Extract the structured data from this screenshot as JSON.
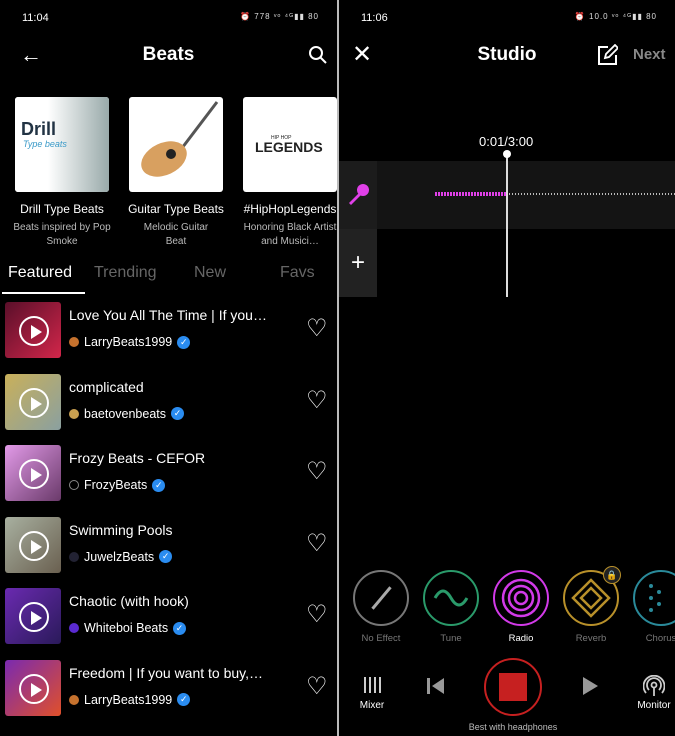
{
  "left": {
    "status": {
      "time": "11:04",
      "icons": "⏰ 778 ᵛᵒ ⁴ᴳ▮▮ 80"
    },
    "header": {
      "title": "Beats",
      "back_icon": "arrow-left-icon",
      "search_icon": "search-icon"
    },
    "collections": [
      {
        "title": "Drill Type Beats",
        "subtitle": "Beats inspired by Pop Smoke",
        "art_text": "Drill",
        "art_sub": "Type beats"
      },
      {
        "title": "Guitar Type Beats",
        "subtitle": "Melodic Guitar Beat"
      },
      {
        "title": "#HipHopLegends",
        "subtitle": "Honoring Black Artist and Musici…",
        "art_text": "LEGENDS",
        "art_sub": "HIP HOP"
      }
    ],
    "tabs": [
      {
        "label": "Featured",
        "active": true
      },
      {
        "label": "Trending"
      },
      {
        "label": "New"
      },
      {
        "label": "Favs"
      }
    ],
    "beats": [
      {
        "title": "Love You All The Time | If you…",
        "author": "LarryBeats1999",
        "colors": [
          "#5a0f2a",
          "#d2264a"
        ],
        "avatar": "#c6722e"
      },
      {
        "title": "complicated",
        "author": "baetovenbeats",
        "colors": [
          "#c9b05a",
          "#8aa0a0"
        ],
        "avatar": "#c9a050"
      },
      {
        "title": "Frozy Beats - CEFOR",
        "author": "FrozyBeats",
        "colors": [
          "#e29ae8",
          "#6a3a6a"
        ],
        "avatar": "#000"
      },
      {
        "title": "Swimming Pools",
        "author": "JuwelzBeats",
        "colors": [
          "#a8b0a0",
          "#6a6050"
        ],
        "avatar": "#223"
      },
      {
        "title": "Chaotic (with hook)",
        "author": "Whiteboi Beats",
        "colors": [
          "#6a2ab0",
          "#2a1a5a"
        ],
        "avatar": "#5a2ad0"
      },
      {
        "title": "Freedom | If you want to buy,…",
        "author": "LarryBeats1999",
        "colors": [
          "#7a2ab0",
          "#e0502a"
        ],
        "avatar": "#c6722e"
      }
    ]
  },
  "right": {
    "status": {
      "time": "11:06",
      "icons": "⏰ 10.0 ᵛᵒ ⁴ᴳ▮▮ 80"
    },
    "header": {
      "title": "Studio",
      "close_icon": "close-icon",
      "edit_icon": "edit-icon",
      "next_label": "Next"
    },
    "timeline": {
      "time": "0:01/3:00",
      "progress_seconds": 1,
      "total_seconds": 180
    },
    "effects": [
      {
        "label": "No Effect",
        "color": "#777"
      },
      {
        "label": "Tune",
        "color": "#2a9a6a"
      },
      {
        "label": "Radio",
        "color": "#d23ae8",
        "selected": true
      },
      {
        "label": "Reverb",
        "color": "#b8902a",
        "locked": true
      },
      {
        "label": "Chorus",
        "color": "#2a8a9a"
      }
    ],
    "controls": {
      "mixer": "Mixer",
      "monitor": "Monitor",
      "hint": "Best with headphones"
    },
    "colors": {
      "accent": "#e040e8",
      "record": "#c62020"
    }
  }
}
